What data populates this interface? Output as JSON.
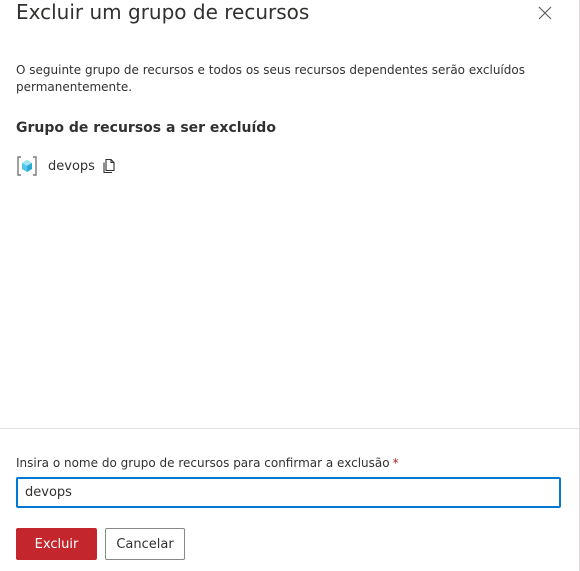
{
  "dialog": {
    "title": "Excluir um grupo de recursos",
    "close_icon": "close-icon",
    "description": "O seguinte grupo de recursos e todos os seus recursos dependentes serão excluídos permanentemente.",
    "section_heading": "Grupo de recursos a ser excluído"
  },
  "resource_group": {
    "name": "devops",
    "icon": "resource-group-icon",
    "copy_icon": "copy-icon"
  },
  "confirm": {
    "label": "Insira o nome do grupo de recursos para confirmar a exclusão",
    "required_marker": "*",
    "value": "devops"
  },
  "buttons": {
    "delete_label": "Excluir",
    "cancel_label": "Cancelar"
  },
  "colors": {
    "danger": "#c4262e",
    "focus_border": "#0078d4",
    "required": "#a4262c"
  }
}
